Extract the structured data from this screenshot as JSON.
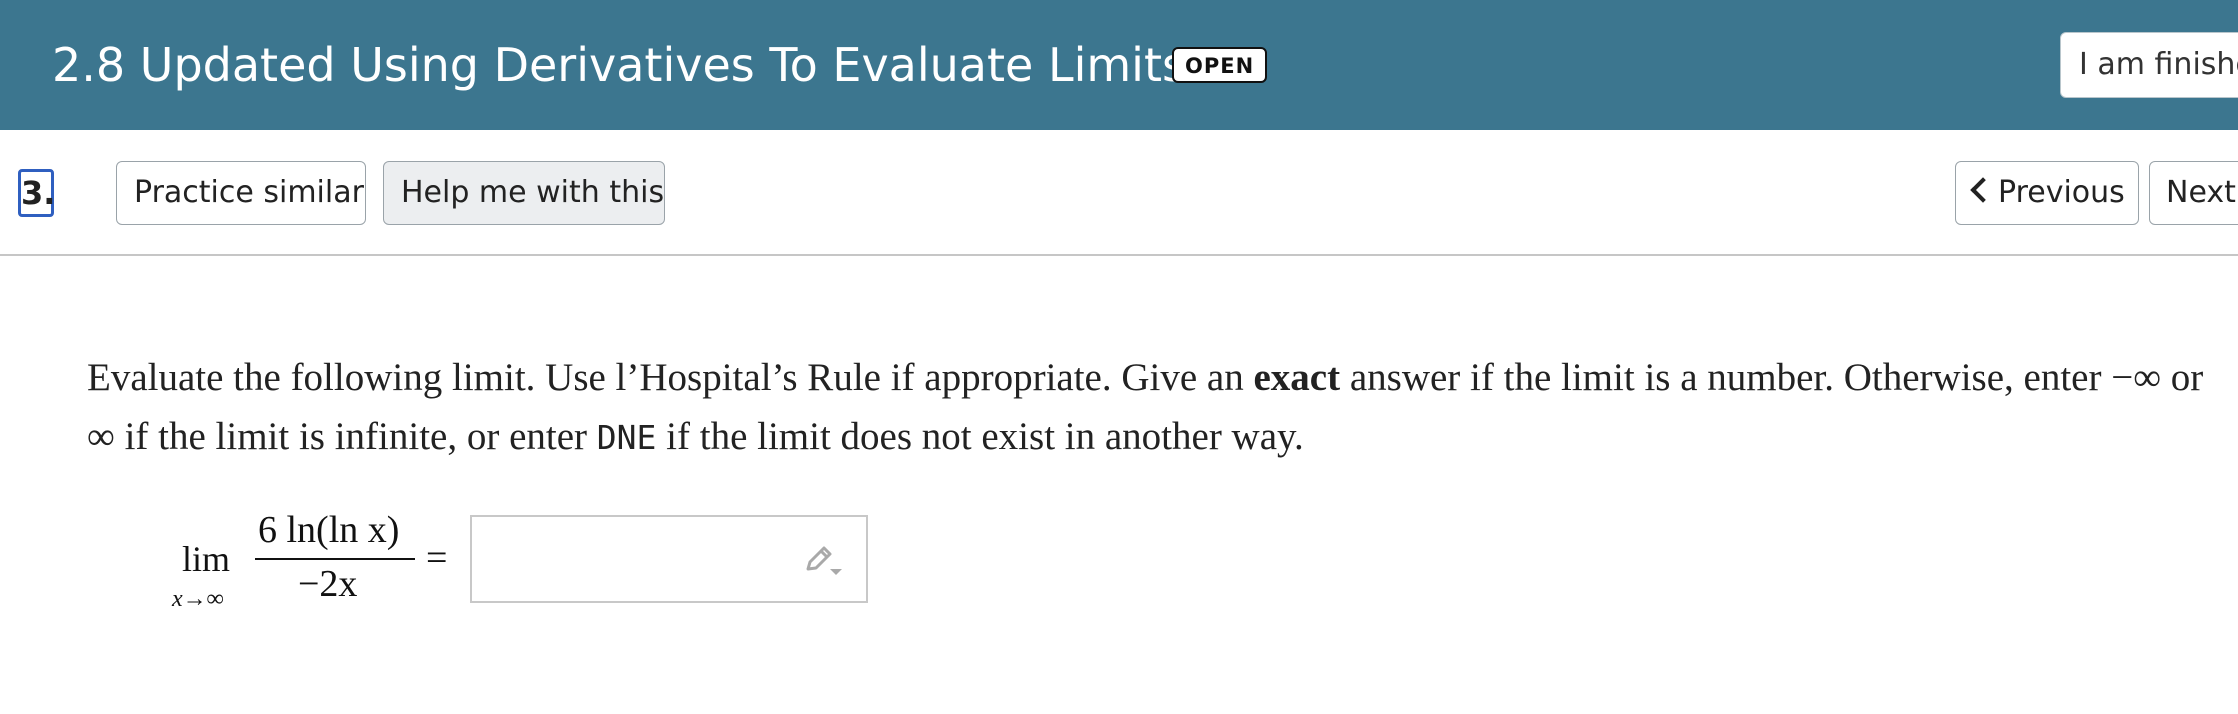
{
  "header": {
    "title": "2.8 Updated Using Derivatives To Evaluate Limits",
    "badge": "OPEN",
    "finished_label": "I am finished"
  },
  "toolbar": {
    "question_number": "3.",
    "practice_label": "Practice similar",
    "help_label": "Help me with this",
    "previous_label": "Previous",
    "next_label": "Next"
  },
  "question": {
    "text_1": "Evaluate the following limit. Use l’Hospital’s Rule if appropriate. Give an ",
    "bold": "exact",
    "text_2": " answer if the limit is a number. Otherwise, enter ",
    "neg_inf": "−∞",
    "or": " or ",
    "inf": "∞",
    "text_3": " if the limit is infinite, or enter ",
    "dne": "DNE",
    "text_4": " if the limit does not exist in another way."
  },
  "math": {
    "lim": "lim",
    "subscript": "x→∞",
    "numerator": "6 ln(ln x)",
    "denominator": "−2x",
    "equals": "="
  },
  "answer": {
    "value": "",
    "icon": "pencil-icon"
  },
  "colors": {
    "header_bg": "#3c768f",
    "focus_border": "#2f5fc0"
  }
}
